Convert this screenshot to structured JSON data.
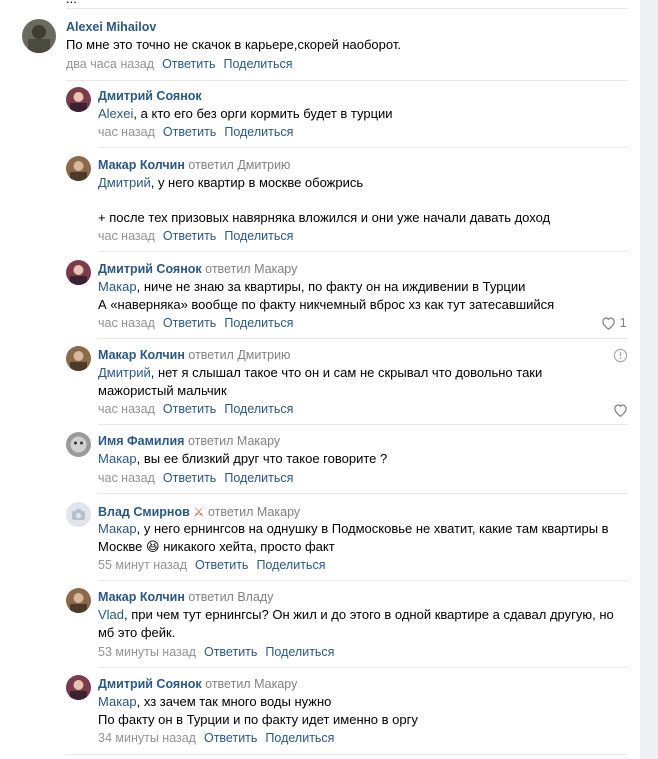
{
  "actions": {
    "reply": "Ответить",
    "share": "Поделиться"
  },
  "replied_prefix": "ответил",
  "top_partial_text": "...",
  "comments": [
    {
      "author": "Alexei Mihailov",
      "text_lines": [
        "По мне это точно не скачок в карьере,скорей наоборот."
      ],
      "time": "два часа назад"
    },
    {
      "author": "Дмитрий Соянок",
      "mention": "Alexei",
      "text_lines": [
        ", а кто его без орги кормить будет в турции"
      ],
      "time": "час назад"
    },
    {
      "author": "Макар Колчин",
      "replied_to": "Дмитрию",
      "mention": "Дмитрий",
      "text_lines": [
        ", у него квартир в москве обожрись",
        "",
        "+ после тех призовых навярняка вложился и они уже начали давать доход"
      ],
      "time": "час назад"
    },
    {
      "author": "Дмитрий Соянок",
      "replied_to": "Макару",
      "mention": "Макар",
      "text_lines": [
        ", ниче не знаю за квартиры, по факту он на иждивении в Турции",
        "А «наверняка» вообще по факту никчемный вброс хз как тут затесавшийся"
      ],
      "time": "час назад",
      "likes": "1"
    },
    {
      "author": "Макар Колчин",
      "replied_to": "Дмитрию",
      "mention": "Дмитрий",
      "text_lines": [
        ", нет я слышал такое что он и сам не скрывал что довольно таки",
        "мажористый мальчик"
      ],
      "time": "час назад"
    },
    {
      "author": "Имя Фамилия",
      "replied_to": "Макару",
      "mention": "Макар",
      "text_lines": [
        ", вы ее близкий друг что такое говорите ?"
      ],
      "time": "час назад"
    },
    {
      "author": "Влад Смирнов",
      "author_badge": "⚔",
      "replied_to": "Макару",
      "mention": "Макар",
      "text_lines": [
        ", у него ернингсов на однушку в Подмосковье не хватит, какие там квартиры в",
        "Москве"
      ],
      "line2_suffix": " никакого хейта, просто факт",
      "emoji": "😆",
      "time": "55 минут назад"
    },
    {
      "author": "Макар Колчин",
      "replied_to": "Владу",
      "mention": "Vlad",
      "text_lines": [
        ", при чем тут ернингсы? Он жил и до этого в одной квартире а сдавал другую, но",
        "мб это фейк."
      ],
      "time": "53 минуты назад"
    },
    {
      "author": "Дмитрий Соянок",
      "replied_to": "Макару",
      "mention": "Макар",
      "text_lines": [
        ", хз зачем так много воды нужно",
        "По факту он в Турции и по факту идет именно в оргу"
      ],
      "time": "34 минуты назад"
    }
  ],
  "colors": {
    "link": "#2a5885",
    "meta": "#939393",
    "separator": "#e7e8ec"
  }
}
